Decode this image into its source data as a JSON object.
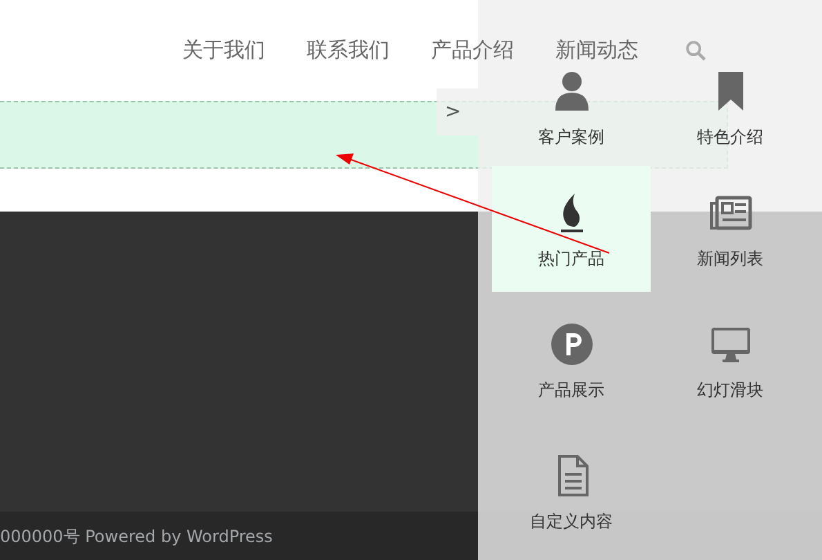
{
  "nav": {
    "items": [
      {
        "label": "关于我们"
      },
      {
        "label": "联系我们"
      },
      {
        "label": "产品介绍"
      },
      {
        "label": "新闻动态"
      }
    ]
  },
  "panel": {
    "toggle": ">",
    "widgets": [
      {
        "label": "客户案例",
        "kind": "person",
        "selected": false
      },
      {
        "label": "特色介绍",
        "kind": "bookmark",
        "selected": false
      },
      {
        "label": "热门产品",
        "kind": "flame",
        "selected": true
      },
      {
        "label": "新闻列表",
        "kind": "newspaper",
        "selected": false
      },
      {
        "label": "产品展示",
        "kind": "p-circle",
        "selected": false
      },
      {
        "label": "幻灯滑块",
        "kind": "monitor",
        "selected": false
      },
      {
        "label": "自定义内容",
        "kind": "document",
        "selected": false
      }
    ]
  },
  "footer": {
    "text": "000000号 Powered by WordPress"
  }
}
